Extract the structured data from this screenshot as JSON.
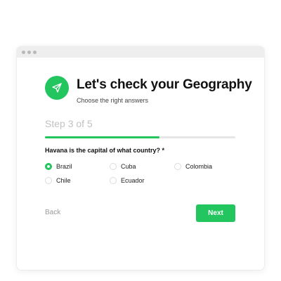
{
  "header": {
    "title": "Let's check your Geography",
    "subtitle": "Choose the right answers",
    "icon": "paper-plane-icon",
    "accent_color": "#22c55e"
  },
  "progress": {
    "step_text": "Step 3 of 5",
    "fraction": 0.6
  },
  "question": {
    "text": "Havana is the capital of what country? *",
    "options": [
      {
        "label": "Brazil",
        "selected": true
      },
      {
        "label": "Cuba",
        "selected": false
      },
      {
        "label": "Colombia",
        "selected": false
      },
      {
        "label": "Chile",
        "selected": false
      },
      {
        "label": "Ecuador",
        "selected": false
      }
    ]
  },
  "nav": {
    "back_label": "Back",
    "next_label": "Next"
  }
}
